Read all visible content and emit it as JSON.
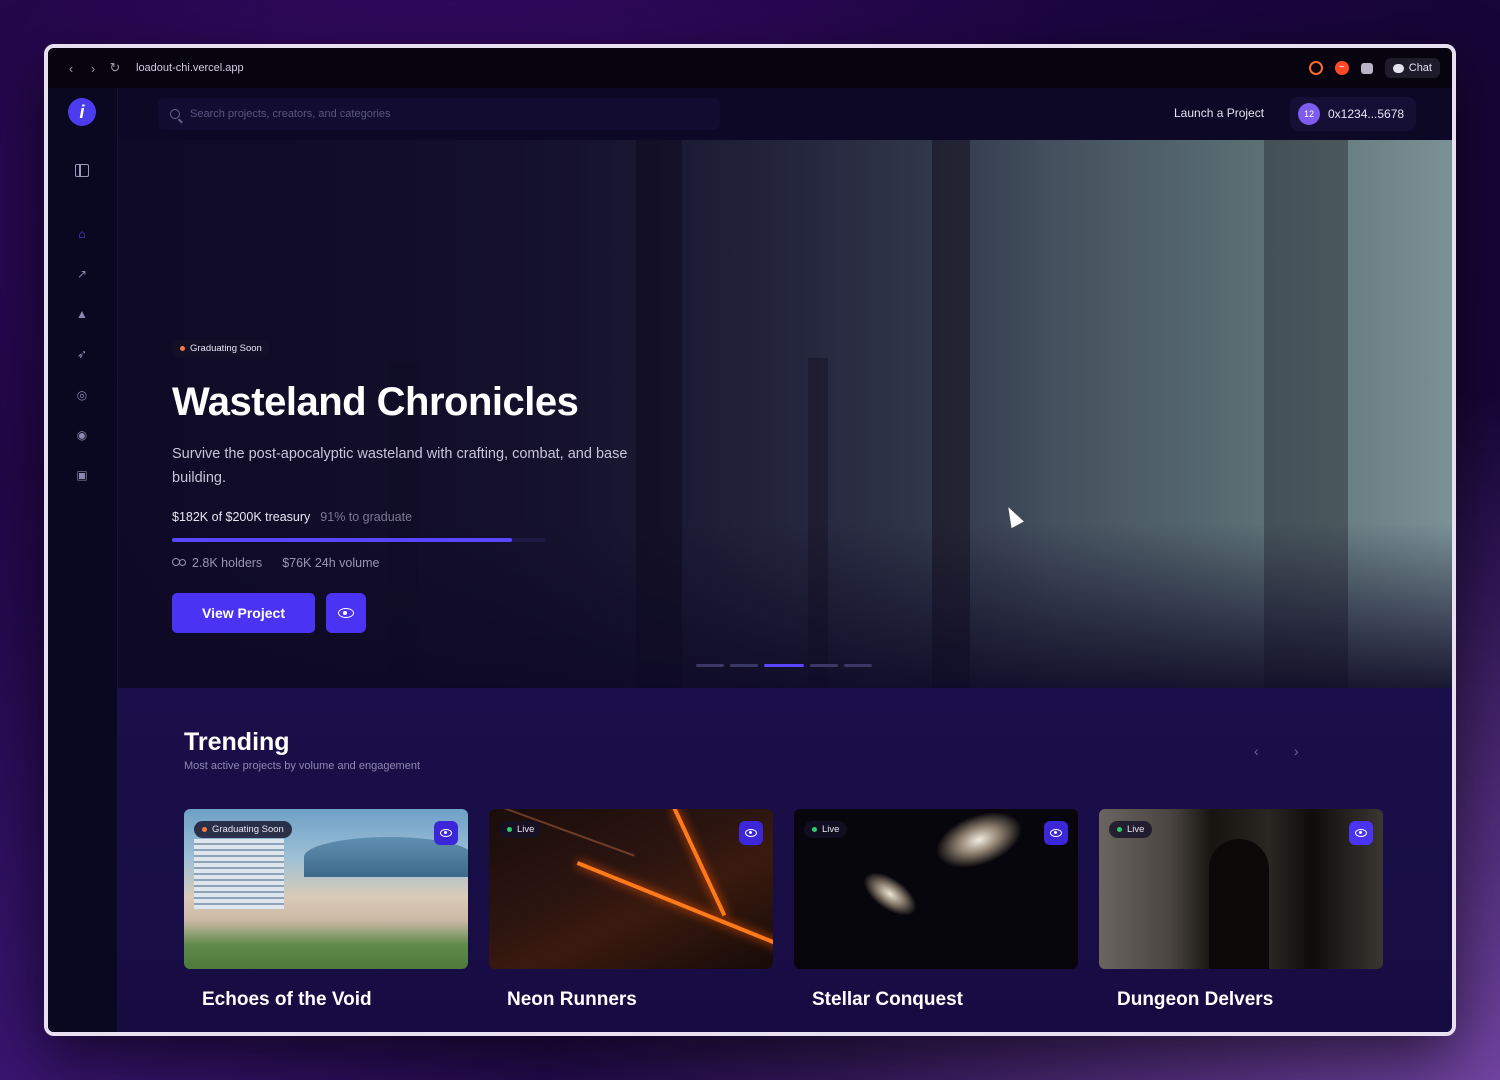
{
  "browser": {
    "url": "loadout-chi.vercel.app",
    "chat_label": "Chat"
  },
  "header": {
    "logo_glyph": "i",
    "search_placeholder": "Search projects, creators, and categories",
    "launch_label": "Launch a Project",
    "wallet_avatar": "12",
    "wallet_address": "0x1234...5678"
  },
  "sidebar": {
    "icons": [
      "panel-toggle-icon",
      "home-icon",
      "trending-icon",
      "graduation-icon",
      "rocket-icon",
      "compass-icon",
      "eye-icon",
      "gift-icon"
    ],
    "active": "home-icon"
  },
  "hero": {
    "badge": "Graduating Soon",
    "badge_color": "#ff7a3a",
    "title": "Wasteland Chronicles",
    "description": "Survive the post-apocalyptic wasteland with crafting, combat, and base building.",
    "treasury": "$182K of $200K treasury",
    "graduate": "91% to graduate",
    "progress": 0.91,
    "holders": "2.8K holders",
    "volume": "$76K 24h volume",
    "cta": "View Project",
    "slides_total": 5,
    "slide_active": 3
  },
  "trending": {
    "title": "Trending",
    "subtitle": "Most active projects by volume and engagement",
    "prev": "‹",
    "next": "›",
    "cards": [
      {
        "title": "Echoes of the Void",
        "badge": "Graduating Soon",
        "badge_color": "#ff7a3a"
      },
      {
        "title": "Neon Runners",
        "badge": "Live",
        "badge_color": "#2ecc71"
      },
      {
        "title": "Stellar Conquest",
        "badge": "Live",
        "badge_color": "#2ecc71"
      },
      {
        "title": "Dungeon Delvers",
        "badge": "Live",
        "badge_color": "#2ecc71"
      }
    ]
  },
  "colors": {
    "accent": "#4a33f2",
    "background": "#0c0826"
  }
}
